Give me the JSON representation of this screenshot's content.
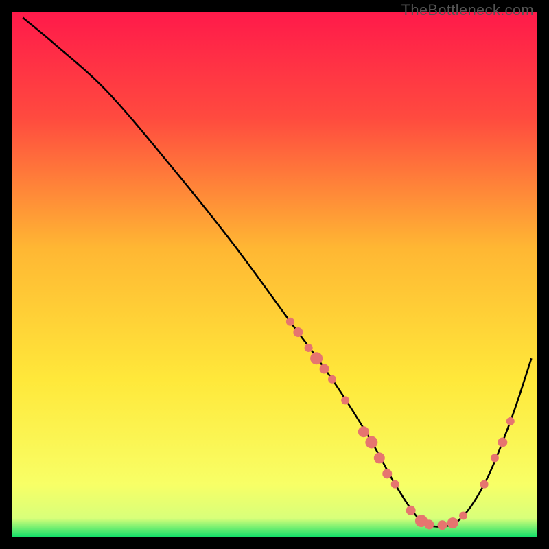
{
  "watermark": "TheBottleneck.com",
  "chart_data": {
    "type": "line",
    "title": "",
    "xlabel": "",
    "ylabel": "",
    "xlim": [
      0,
      100
    ],
    "ylim": [
      0,
      100
    ],
    "background_gradient": {
      "stops": [
        {
          "offset": 0.0,
          "color": "#ff1a4a"
        },
        {
          "offset": 0.2,
          "color": "#ff4a3f"
        },
        {
          "offset": 0.45,
          "color": "#ffb733"
        },
        {
          "offset": 0.7,
          "color": "#ffe83a"
        },
        {
          "offset": 0.9,
          "color": "#f8ff66"
        },
        {
          "offset": 0.965,
          "color": "#d8ff7a"
        },
        {
          "offset": 1.0,
          "color": "#14e06a"
        }
      ]
    },
    "series": [
      {
        "name": "bottleneck-curve",
        "x": [
          2,
          8,
          18,
          30,
          42,
          53,
          61,
          68,
          73,
          77,
          80,
          85,
          90,
          95,
          99
        ],
        "y": [
          99,
          94,
          85,
          71,
          56,
          41,
          30,
          19,
          10,
          4,
          2,
          3,
          10,
          22,
          34
        ]
      }
    ],
    "markers": {
      "name": "highlight-points",
      "color": "#e6756f",
      "points": [
        {
          "x": 53,
          "y": 41,
          "r": 6
        },
        {
          "x": 54.5,
          "y": 39,
          "r": 7
        },
        {
          "x": 56.5,
          "y": 36,
          "r": 6
        },
        {
          "x": 58,
          "y": 34,
          "r": 9
        },
        {
          "x": 59.5,
          "y": 32,
          "r": 7
        },
        {
          "x": 61,
          "y": 30,
          "r": 6
        },
        {
          "x": 63.5,
          "y": 26,
          "r": 6
        },
        {
          "x": 67,
          "y": 20,
          "r": 8
        },
        {
          "x": 68.5,
          "y": 18,
          "r": 9
        },
        {
          "x": 70,
          "y": 15,
          "r": 8
        },
        {
          "x": 71.5,
          "y": 12,
          "r": 7
        },
        {
          "x": 73,
          "y": 10,
          "r": 6
        },
        {
          "x": 76,
          "y": 5,
          "r": 7
        },
        {
          "x": 78,
          "y": 3,
          "r": 9
        },
        {
          "x": 79.5,
          "y": 2.3,
          "r": 7
        },
        {
          "x": 82,
          "y": 2.2,
          "r": 7
        },
        {
          "x": 84,
          "y": 2.6,
          "r": 8
        },
        {
          "x": 86,
          "y": 4,
          "r": 6
        },
        {
          "x": 90,
          "y": 10,
          "r": 6
        },
        {
          "x": 92,
          "y": 15,
          "r": 6
        },
        {
          "x": 93.5,
          "y": 18,
          "r": 7
        },
        {
          "x": 95,
          "y": 22,
          "r": 6
        }
      ]
    }
  }
}
